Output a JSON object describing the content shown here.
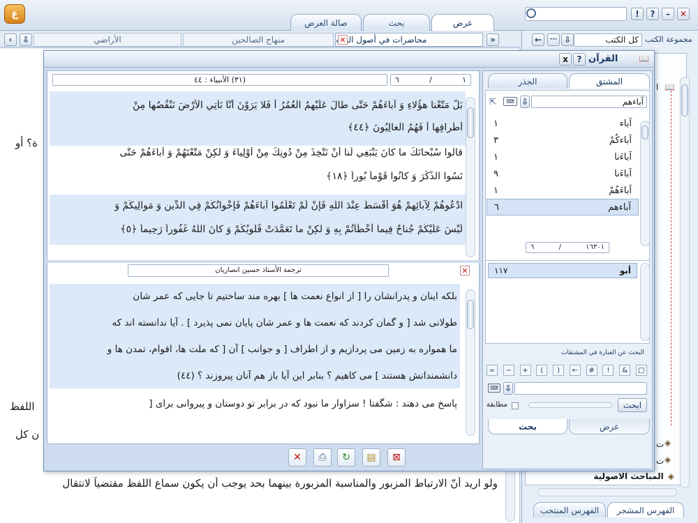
{
  "main_tabs": [
    {
      "label": "عرض",
      "active": true
    },
    {
      "label": "بحث",
      "active": false
    },
    {
      "label": "صالة العرض",
      "active": false
    }
  ],
  "doc_tabs": [
    {
      "label": "محاضرات في أصول الفقه",
      "active": true
    },
    {
      "label": "منهاج الصالحين",
      "active": false
    },
    {
      "label": "الأراضي",
      "active": false
    }
  ],
  "right_pane": {
    "books_label": "مجموعة الكتب",
    "books_value": "كل الكتب",
    "tree_items": [
      "المباحث الاصولية"
    ],
    "tabs": [
      "الفهرس المشجر",
      "الفهرس المنتخب"
    ]
  },
  "background_text": {
    "line1": "ة؟ أو",
    "line2": "اللفظ",
    "line3": "ن كل",
    "bottom_line": "ولو اريد أنّ الارتباط المزبور والمناسبة المزبورة بينهما بحد يوجب أن يكون سماع اللفظ مقتضياً لانتقال"
  },
  "quran_window": {
    "title": "القرآن",
    "help_label": "?",
    "close_label": "x",
    "nav": {
      "verse_number": "٦",
      "verse_total": "١",
      "surah_info": "(٣١) الأنبياء : ٤٤"
    },
    "quran_lines": [
      "بَلْ مَتَّعْنا هؤُلاءِ وَ آباءَهُمْ حَتَّى طالَ عَلَيْهِمُ الْعُمُرُ أَ فَلا يَرَوْنَ أَنَّا نَأْتِي الْأَرْضَ نَنْقُصُها مِنْ",
      "أَطْرافِها أَ فَهُمُ الْغالِبُونَ ﴿٤٤﴾",
      "قالُوا سُبْحانَكَ ما كانَ يَنْبَغِي لَنا أَنْ نَتَّخِذَ مِنْ دُونِكَ مِنْ أَوْلِياءَ وَ لكِنْ مَتَّعْتَهُمْ وَ آباءَهُمْ حَتَّى",
      "نَسُوا الذِّكْرَ وَ كانُوا قَوْماً بُوراً ﴿١٨﴾",
      "ادْعُوهُمْ لِآبائِهِمْ هُوَ أَقْسَطُ عِنْدَ اللَّهِ فَإِنْ لَمْ تَعْلَمُوا آباءَهُمْ فَإِخْوانُكُمْ فِي الدِّينِ وَ مَوالِيكُمْ وَ",
      "لَيْسَ عَلَيْكُمْ جُناحٌ فِيما أَخْطَأْتُمْ بِهِ وَ لكِنْ ما تَعَمَّدَتْ قُلُوبُكُمْ وَ كانَ اللَّهُ غَفُوراً رَحِيماً ﴿٥﴾"
    ],
    "translation_title": "ترجمة الأستاذ حسين انصاريان",
    "translation_lines": [
      "بلكه اينان و پدرانشان را [ از انواع نعمت ها ] بهره مند ساختيم تا جايى كه عمر شان",
      "طولانى شد [ و گمان كردند كه نعمت ها و عمر شان پايان نمى پذيرد ] . آيا ندانسته اند كه",
      "ما همواره به زمين مى پردازيم و از اطراف [ و جوانب ] آن [ كه ملت ها، اقوام، تمدن ها و",
      "دانشمندانش هستند ] مى كاهيم ؟ بنابر اين آيا باز هم آنان پيروزند ؟ (٤٤)",
      "پاسخ مى دهند : شگفتا ! سزاوار ما نبود كه در برابر تو دوستان و پيروانى براى ["
    ],
    "side_tabs": [
      "المشتق",
      "الجذر"
    ],
    "search_value": "آباءهم",
    "derivatives": [
      {
        "word": "آباء",
        "count": "١"
      },
      {
        "word": "آباءكُمْ",
        "count": "٣"
      },
      {
        "word": "آباءَنا",
        "count": "١"
      },
      {
        "word": "آباءَنا",
        "count": "٩"
      },
      {
        "word": "آباءَهُمْ",
        "count": "١"
      },
      {
        "word": "آباءهم",
        "count": "٦"
      }
    ],
    "counts": {
      "left": "٦",
      "right": "١٦٣٠١"
    },
    "root_result": {
      "word": "أبو",
      "count": "١١٧"
    },
    "phrase_search_label": "البحث عن العبارة في المشتقات",
    "symbols": [
      "=",
      "−",
      "+",
      "(",
      ")",
      "←",
      "#",
      "!",
      "&",
      "□"
    ],
    "search_button": "ابحث",
    "match_label": "مطابقة",
    "bottom_tabs": [
      "عرض",
      "بحث"
    ]
  },
  "colors": {
    "accent": "#1d4f8c",
    "highlight": "#dbe8f7",
    "quran_green": "#2a8a2a",
    "close_red": "#c01515"
  }
}
